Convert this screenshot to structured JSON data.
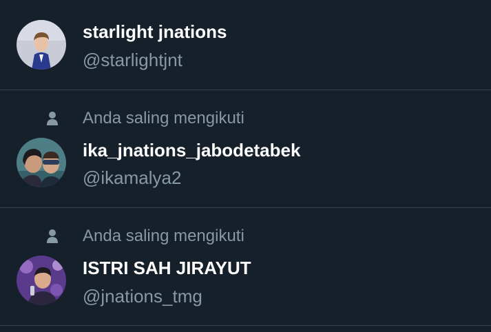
{
  "colors": {
    "background": "#15202b",
    "divider": "#38444d",
    "primary_text": "#ffffff",
    "secondary_text": "#8899a6"
  },
  "users": [
    {
      "display_name": "starlight jnations",
      "handle": "@starlightjnt",
      "social_context": ""
    },
    {
      "display_name": "ika_jnations_jabodetabek",
      "handle": "@ikamalya2",
      "social_context": "Anda saling mengikuti",
      "social_icon": "person-icon"
    },
    {
      "display_name": "ISTRI SAH JIRAYUT",
      "handle": "@jnations_tmg",
      "social_context": "Anda saling mengikuti",
      "social_icon": "person-icon"
    }
  ]
}
